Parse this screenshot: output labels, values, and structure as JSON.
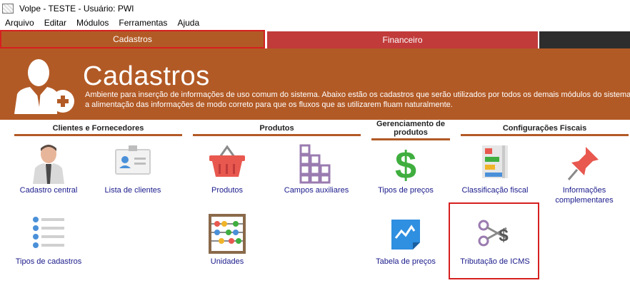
{
  "window": {
    "title": "Volpe - TESTE - Usuário: PWI"
  },
  "menu": [
    "Arquivo",
    "Editar",
    "Módulos",
    "Ferramentas",
    "Ajuda"
  ],
  "tabs": [
    {
      "label": "Cadastros",
      "active": true
    },
    {
      "label": "Financeiro",
      "active": false
    },
    {
      "label": "",
      "active": false
    }
  ],
  "banner": {
    "title": "Cadastros",
    "description": "Ambiente para inserção de informações de uso comum do sistema. Abaixo estão os cadastros que serão utilizados por todos os demais módulos do sistema, faça a alimentação das informações de modo correto para que os fluxos que as utilizarem fluam naturalmente."
  },
  "sections": {
    "clientes": "Clientes e Fornecedores",
    "produtos": "Produtos",
    "gerenciamento": "Gerenciamento de produtos",
    "fiscais": "Configurações Fiscais"
  },
  "tiles": {
    "cadastro_central": "Cadastro central",
    "lista_clientes": "Lista de clientes",
    "produtos": "Produtos",
    "campos_auxiliares": "Campos auxiliares",
    "tipos_precos": "Tipos de preços",
    "classificacao_fiscal": "Classificação fiscal",
    "informacoes_complementares": "Informações complementares",
    "tipos_cadastros": "Tipos de cadastros",
    "unidades": "Unidades",
    "tabela_precos": "Tabela de preços",
    "tributacao_icms": "Tributação de ICMS"
  },
  "colors": {
    "banner": "#b25a26",
    "tab_financeiro": "#c13b3b",
    "highlight": "#d62020",
    "link": "#1a1a8c"
  }
}
